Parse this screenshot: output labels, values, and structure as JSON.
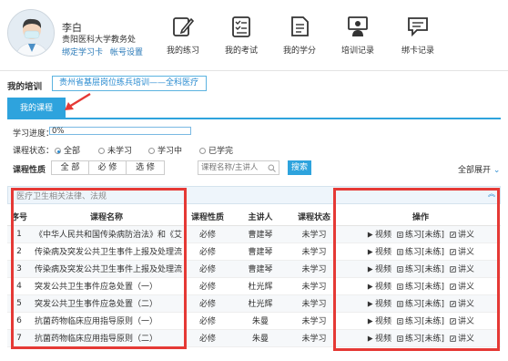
{
  "user": {
    "name": "李白",
    "org": "贵阳医科大学教务处",
    "bind_card": "绑定学习卡",
    "account_settings": "帐号设置"
  },
  "nav": [
    {
      "label": "我的练习",
      "icon": "pen-icon"
    },
    {
      "label": "我的考试",
      "icon": "checklist-icon"
    },
    {
      "label": "我的学分",
      "icon": "credit-doc-icon"
    },
    {
      "label": "培训记录",
      "icon": "training-person-icon"
    },
    {
      "label": "绑卡记录",
      "icon": "chat-card-icon"
    }
  ],
  "training": {
    "label": "我的培训",
    "selected": "贵州省基层岗位练兵培训——全科医疗"
  },
  "tab": {
    "label": "我的课程"
  },
  "progress": {
    "label": "学习进度：",
    "value_text": "0%",
    "value": 0
  },
  "filters": {
    "status_label": "课程状态：",
    "status_options": [
      "全部",
      "未学习",
      "学习中",
      "已学完"
    ],
    "status_selected": 0,
    "nature_label": "课程性质",
    "nature_options": [
      "全 部",
      "必 修",
      "选 修"
    ],
    "search_placeholder": "课程名称/主讲人",
    "search_button": "搜索",
    "expand_all": "全部展开"
  },
  "section": {
    "title": "医疗卫生相关法律、法规"
  },
  "table": {
    "headers": [
      "序号",
      "课程名称",
      "课程性质",
      "主讲人",
      "课程状态",
      "操作"
    ],
    "actions": [
      "视频",
      "练习[未练]",
      "讲义"
    ],
    "rows": [
      {
        "no": "1",
        "name": "《中华人民共和国传染病防治法》和《艾滋病",
        "nature": "必修",
        "lecturer": "曹建琴",
        "status": "未学习"
      },
      {
        "no": "2",
        "name": "传染病及突发公共卫生事件上报及处理流程",
        "nature": "必修",
        "lecturer": "曹建琴",
        "status": "未学习"
      },
      {
        "no": "3",
        "name": "传染病及突发公共卫生事件上报及处理流程",
        "nature": "必修",
        "lecturer": "曹建琴",
        "status": "未学习"
      },
      {
        "no": "4",
        "name": "突发公共卫生事件应急处置（一）",
        "nature": "必修",
        "lecturer": "杜光辉",
        "status": "未学习"
      },
      {
        "no": "5",
        "name": "突发公共卫生事件应急处置（二）",
        "nature": "必修",
        "lecturer": "杜光辉",
        "status": "未学习"
      },
      {
        "no": "6",
        "name": "抗菌药物临床应用指导原则（一）",
        "nature": "必修",
        "lecturer": "朱曼",
        "status": "未学习"
      },
      {
        "no": "7",
        "name": "抗菌药物临床应用指导原则（二）",
        "nature": "必修",
        "lecturer": "朱曼",
        "status": "未学习"
      }
    ]
  },
  "colors": {
    "accent": "#2ea3dd",
    "highlight": "#e53935",
    "link": "#2a7ab8"
  }
}
